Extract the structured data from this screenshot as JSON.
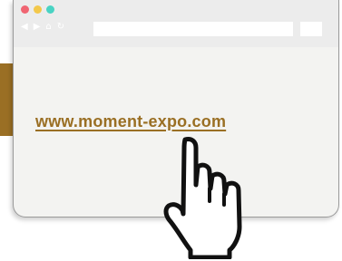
{
  "window": {
    "controls": [
      {
        "name": "close",
        "color": "#f06572"
      },
      {
        "name": "minimize",
        "color": "#f3c84b"
      },
      {
        "name": "maximize",
        "color": "#49d3c3"
      }
    ],
    "nav_icons": [
      {
        "name": "back-icon",
        "glyph": "◀"
      },
      {
        "name": "forward-icon",
        "glyph": "▶"
      },
      {
        "name": "home-icon",
        "glyph": "⌂"
      },
      {
        "name": "reload-icon",
        "glyph": "↻"
      }
    ],
    "address_bar_value": ""
  },
  "content": {
    "link_text": "www.moment-expo.com"
  },
  "colors": {
    "accent": "#9a6f24",
    "window_bg": "#f3f3f1",
    "title_bar_bg": "#ececec",
    "border": "#9a9a9a"
  },
  "cursor": {
    "icon": "hand-pointer-icon"
  }
}
